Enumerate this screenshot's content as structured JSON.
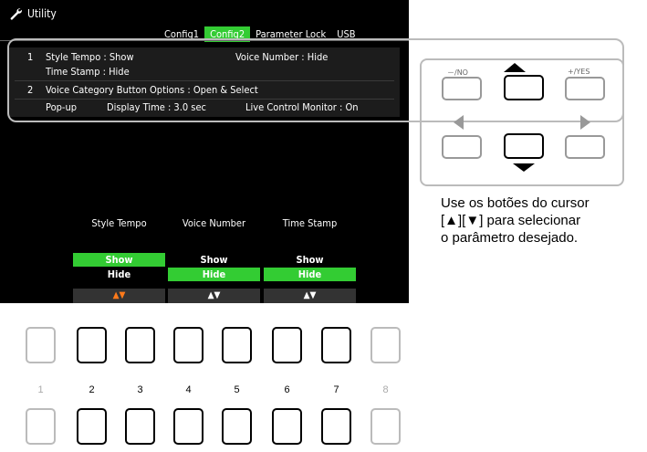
{
  "screen": {
    "title": "Utility",
    "tabs": [
      "Config1",
      "Config2",
      "Parameter Lock",
      "USB"
    ],
    "active_tab_index": 1,
    "rows": {
      "r1_num": "1",
      "r1_a": "Style Tempo : Show",
      "r1_b": "Voice Number : Hide",
      "r1_c": "Time Stamp : Hide",
      "r2_num": "2",
      "r2_a": "Voice Category Button Options : Open & Select",
      "r3_a": "Pop-up",
      "r3_b": "Display Time : 3.0 sec",
      "r3_c": "Live Control Monitor : On"
    },
    "columns": [
      {
        "header": "Style Tempo",
        "show": "Show",
        "hide": "Hide",
        "selected": "Show",
        "arrows": "▲▼",
        "arrows_color": "#ff7a1a"
      },
      {
        "header": "Voice Number",
        "show": "Show",
        "hide": "Hide",
        "selected": "Hide",
        "arrows": "▲▼",
        "arrows_color": "#ffffff"
      },
      {
        "header": "Time Stamp",
        "show": "Show",
        "hide": "Hide",
        "selected": "Hide",
        "arrows": "▲▼",
        "arrows_color": "#ffffff"
      }
    ]
  },
  "cursor_panel": {
    "no_label": "－/NO",
    "yes_label": "+/YES"
  },
  "description": {
    "line1": "Use os botões do cursor",
    "line2": "[▲][▼] para selecionar",
    "line3": "o parâmetro desejado."
  },
  "bottom_buttons": {
    "numbers": [
      "1",
      "2",
      "3",
      "4",
      "5",
      "6",
      "7",
      "8"
    ]
  },
  "colors": {
    "accent_green": "#33cc33",
    "lcd_background": "#000000"
  }
}
